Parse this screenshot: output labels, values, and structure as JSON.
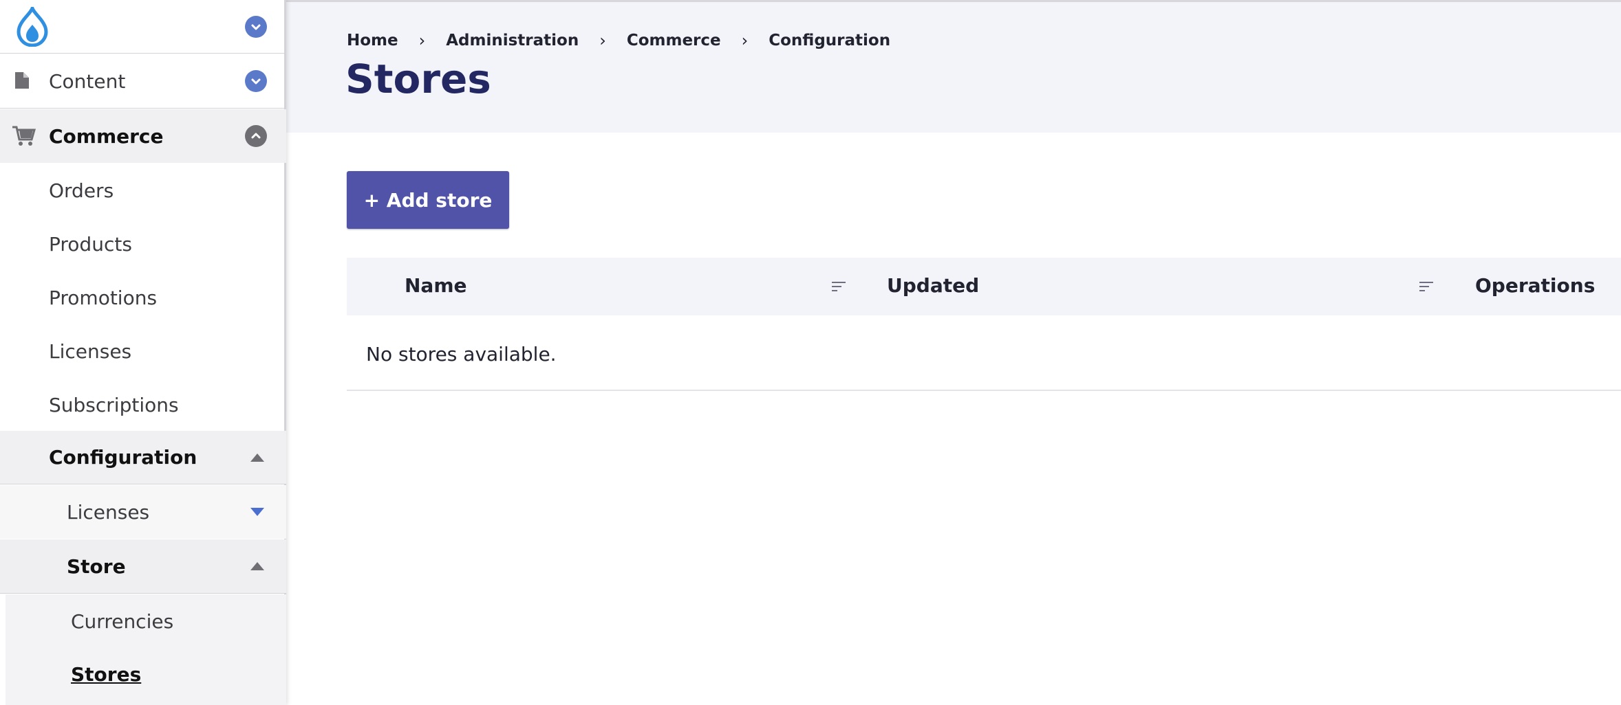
{
  "sidebar": {
    "content_label": "Content",
    "commerce_label": "Commerce",
    "commerce_items": [
      "Orders",
      "Products",
      "Promotions",
      "Licenses",
      "Subscriptions"
    ],
    "configuration_label": "Configuration",
    "config_licenses_label": "Licenses",
    "store_label": "Store",
    "store_items": [
      "Currencies",
      "Stores"
    ]
  },
  "header": {
    "breadcrumb": [
      "Home",
      "Administration",
      "Commerce",
      "Configuration"
    ],
    "title": "Stores"
  },
  "toolbar": {
    "add_store_label": "+ Add store"
  },
  "table": {
    "columns": [
      "Name",
      "Updated",
      "Operations"
    ],
    "empty_message": "No stores available."
  },
  "colors": {
    "accent": "#5053a8",
    "title": "#232762",
    "header_bg": "#f3f4f9"
  },
  "icons": [
    "drupal-logo",
    "page-icon",
    "cart-icon",
    "chevron-down-icon",
    "chevron-up-icon",
    "sort-icon"
  ]
}
